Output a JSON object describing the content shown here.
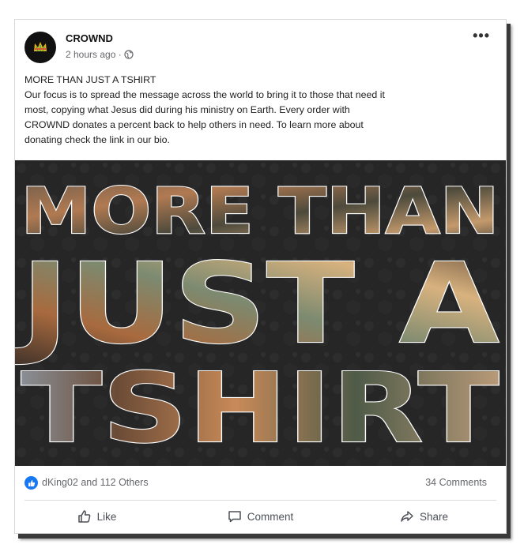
{
  "post": {
    "author": "CROWND",
    "timestamp": "2 hours ago ·",
    "audience_icon": "globe-icon",
    "more_label": "•••",
    "headline": "MORE THAN JUST A TSHIRT",
    "body": "Our focus is to spread the message across the world to bring it to those that need it most, copying what Jesus did during his ministry on Earth. Every order with CROWND donates a percent back to help others in need. To learn more about donating check the link in our bio.",
    "image_text": {
      "line1": "MORE THAN",
      "line2": "JUST A",
      "line3": "TSHIRT"
    }
  },
  "reactions": {
    "summary": "dKing02 and 112 Others",
    "comments": "34 Comments"
  },
  "actions": {
    "like": "Like",
    "comment": "Comment",
    "share": "Share"
  },
  "colors": {
    "brand_blue": "#1877f2",
    "image_bg": "#262626",
    "accent_gold": "#e2b41a"
  }
}
